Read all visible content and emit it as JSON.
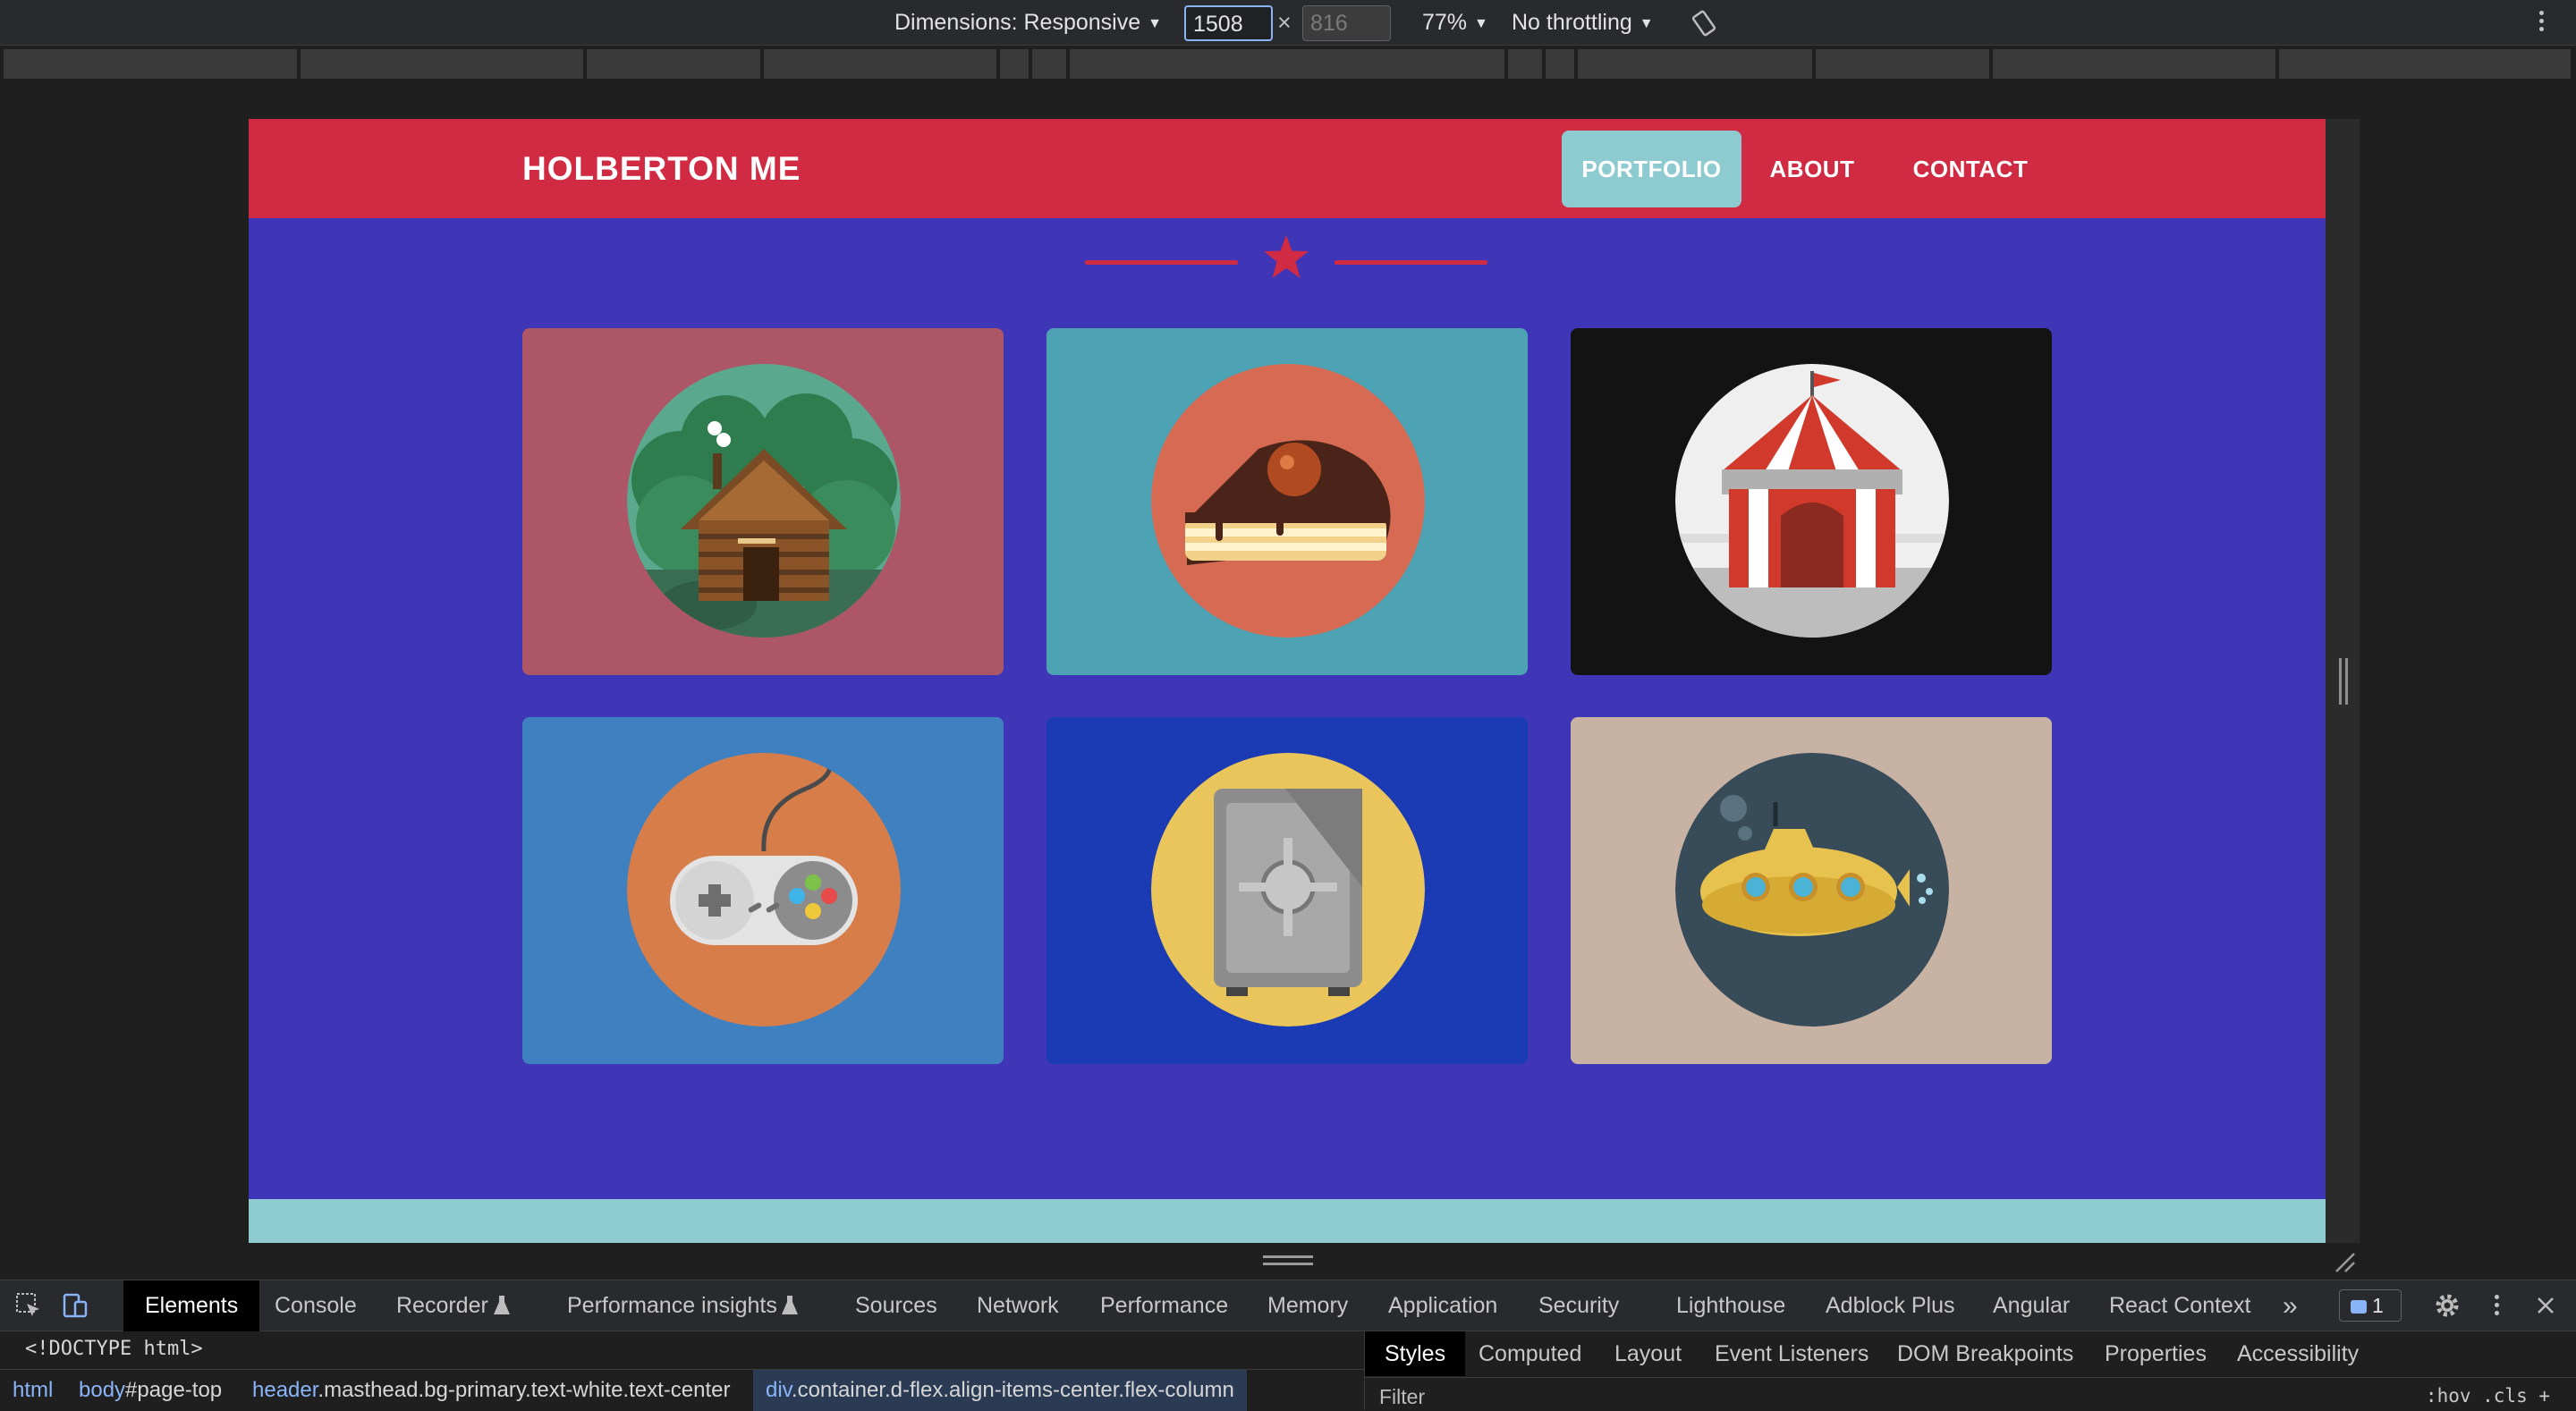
{
  "device_toolbar": {
    "dimensions_label": "Dimensions: Responsive",
    "width_value": "1508",
    "height_placeholder": "816",
    "times": "×",
    "zoom": "77%",
    "throttling": "No throttling",
    "caret": "▼"
  },
  "site": {
    "brand": "HOLBERTON ME",
    "nav": [
      "PORTFOLIO",
      "ABOUT",
      "CONTACT"
    ],
    "active_nav": "PORTFOLIO",
    "colors": {
      "nav_bg": "#d02b43",
      "masthead_bg": "#3e35b7",
      "active_link_bg": "#8ecbd0",
      "footer_strip": "#8ecbd0"
    },
    "portfolio": [
      {
        "name": "cabin",
        "bg": "#ad5667",
        "disc": "#5aa98e"
      },
      {
        "name": "cake",
        "bg": "#4da2b4",
        "disc": "#d66a52"
      },
      {
        "name": "circus",
        "bg": "#131313",
        "disc": "#efefef"
      },
      {
        "name": "game",
        "bg": "#3f81c0",
        "disc": "#d77d4a"
      },
      {
        "name": "safe",
        "bg": "#1a3bb3",
        "disc": "#e9c55b"
      },
      {
        "name": "submarine",
        "bg": "#c8b2a4",
        "disc": "#374c58"
      }
    ]
  },
  "devtools": {
    "tabs": [
      "Elements",
      "Console",
      "Recorder",
      "Performance insights",
      "Sources",
      "Network",
      "Performance",
      "Memory",
      "Application",
      "Security",
      "Lighthouse",
      "Adblock Plus",
      "Angular",
      "React Context"
    ],
    "active_tab": "Elements",
    "more": "»",
    "issues_count": "1",
    "doctype": "<!DOCTYPE html>",
    "breadcrumbs": [
      {
        "tag": "html",
        "rest": ""
      },
      {
        "tag": "body",
        "rest": "#page-top"
      },
      {
        "tag": "header",
        "rest": ".masthead.bg-primary.text-white.text-center"
      },
      {
        "tag": "div",
        "rest": ".container.d-flex.align-items-center.flex-column"
      }
    ],
    "styles_tabs": [
      "Styles",
      "Computed",
      "Layout",
      "Event Listeners",
      "DOM Breakpoints",
      "Properties",
      "Accessibility"
    ],
    "filter_placeholder": "Filter",
    "filter_tools": ":hov  .cls  +"
  }
}
